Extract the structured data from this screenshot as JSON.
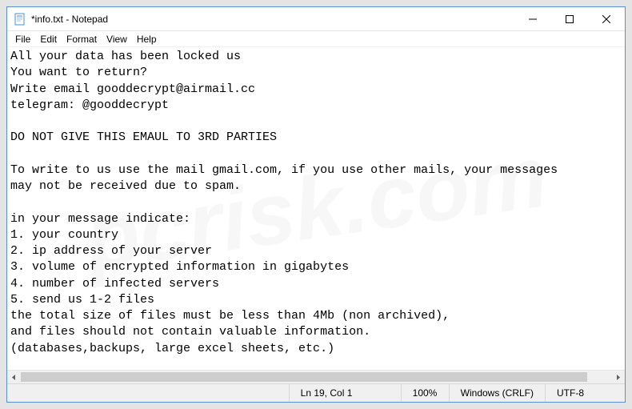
{
  "titlebar": {
    "title": "*info.txt - Notepad"
  },
  "menu": {
    "file": "File",
    "edit": "Edit",
    "format": "Format",
    "view": "View",
    "help": "Help"
  },
  "content": {
    "text": "All your data has been locked us\nYou want to return?\nWrite email gooddecrypt@airmail.cc\ntelegram: @gooddecrypt\n\nDO NOT GIVE THIS EMAUL TO 3RD PARTIES\n\nTo write to us use the mail gmail.com, if you use other mails, your messages \nmay not be received due to spam.\n\nin your message indicate:\n1. your country\n2. ip address of your server\n3. volume of encrypted information in gigabytes\n4. number of infected servers\n5. send us 1-2 files\nthe total size of files must be less than 4Mb (non archived), \nand files should not contain valuable information.\n(databases,backups, large excel sheets, etc.)"
  },
  "status": {
    "position": "Ln 19, Col 1",
    "zoom": "100%",
    "line_ending": "Windows (CRLF)",
    "encoding": "UTF-8"
  },
  "watermark": "pcrisk.com"
}
